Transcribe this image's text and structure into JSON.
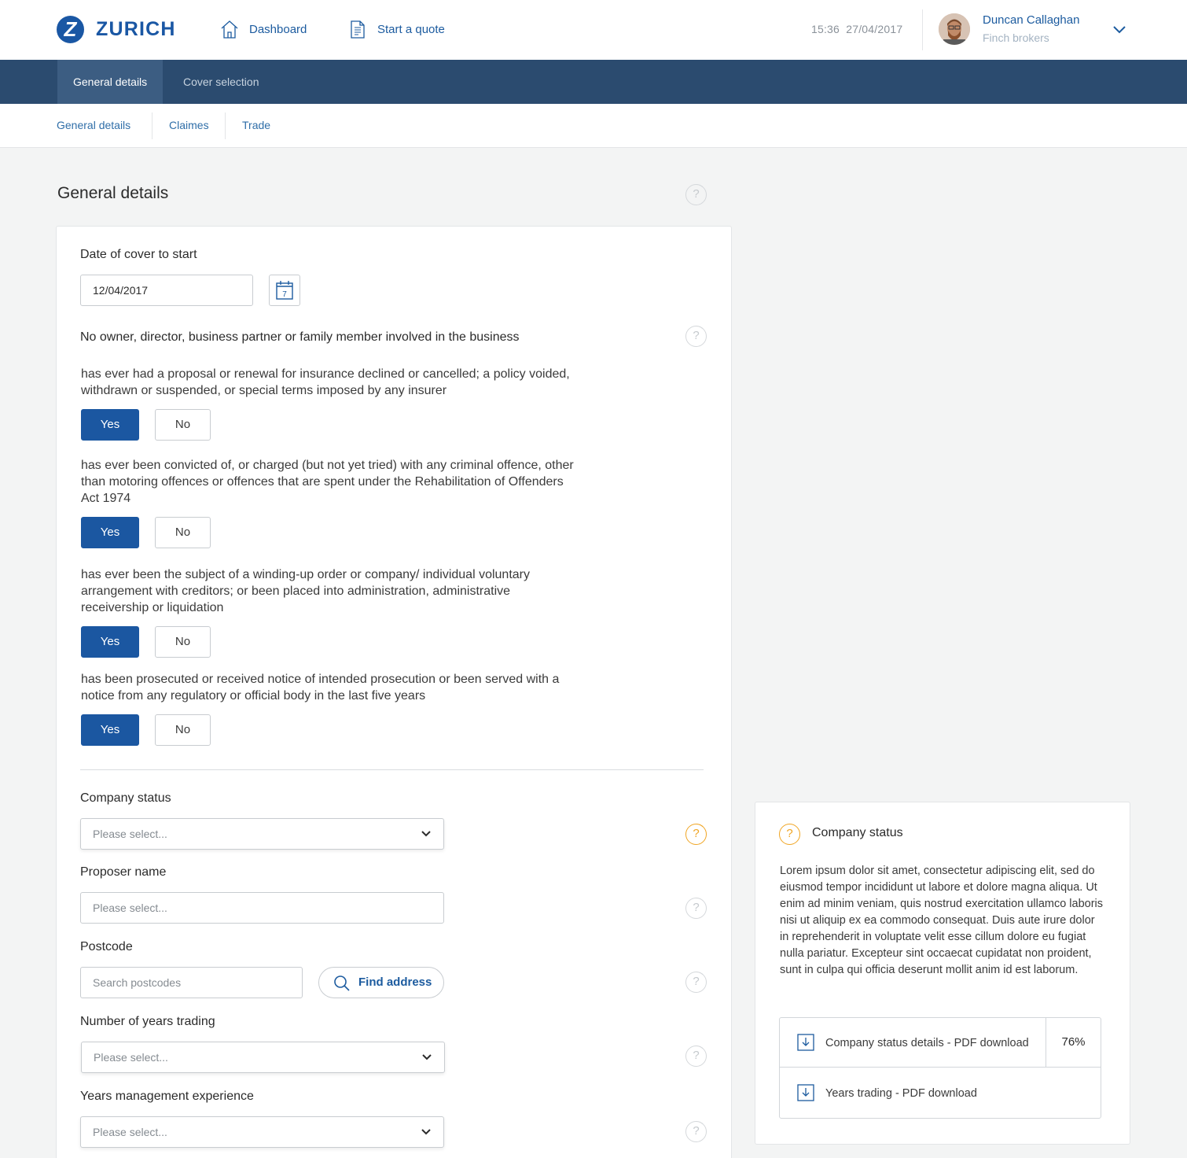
{
  "header": {
    "brand": "ZURICH",
    "logo_letter": "Z",
    "nav": [
      {
        "label": "Dashboard",
        "icon": "home-icon"
      },
      {
        "label": "Start a quote",
        "icon": "document-icon"
      }
    ],
    "time": "15:36",
    "date": "27/04/2017",
    "user": {
      "name": "Duncan Callaghan",
      "org": "Finch brokers"
    }
  },
  "tabs": [
    {
      "label": "General details",
      "active": true
    },
    {
      "label": "Cover selection",
      "active": false
    }
  ],
  "subnav": [
    "General details",
    "Claimes",
    "Trade"
  ],
  "page_title": "General details",
  "form": {
    "date_label": "Date of cover to start",
    "date_value": "12/04/2017",
    "calendar_day": "7",
    "questions_heading": "No owner, director, business partner or family member involved in the business",
    "questions": [
      {
        "text": "has ever had a proposal or renewal for insurance declined or cancelled; a policy voided, withdrawn or suspended, or special terms imposed by any insurer",
        "yes": "Yes",
        "no": "No",
        "selected": "Yes"
      },
      {
        "text": "has ever been convicted of, or charged (but not yet tried) with any criminal offence, other than motoring offences or offences that are spent under the Rehabilitation of Offenders Act 1974",
        "yes": "Yes",
        "no": "No",
        "selected": "Yes"
      },
      {
        "text": "has ever been the subject of a winding-up order or company/ individual voluntary arrangement with creditors; or been placed into administration, administrative receivership or liquidation",
        "yes": "Yes",
        "no": "No",
        "selected": "Yes"
      },
      {
        "text": "has been prosecuted or received notice of intended prosecution or been served with a notice from any regulatory or official body in the last five years",
        "yes": "Yes",
        "no": "No",
        "selected": "Yes"
      }
    ],
    "company_status": {
      "label": "Company status",
      "placeholder": "Please select..."
    },
    "proposer_name": {
      "label": "Proposer name",
      "placeholder": "Please select..."
    },
    "postcode": {
      "label": "Postcode",
      "placeholder": "Search postcodes",
      "button": "Find address"
    },
    "years_trading": {
      "label": "Number of years trading",
      "placeholder": "Please select..."
    },
    "mgmt_experience": {
      "label": "Years management experience",
      "placeholder": "Please select..."
    }
  },
  "help_panel": {
    "title": "Company status",
    "body": "Lorem ipsum dolor sit amet, consectetur adipiscing elit, sed do eiusmod tempor incididunt ut labore et dolore magna aliqua. Ut enim ad minim veniam, quis nostrud exercitation ullamco laboris nisi ut aliquip ex ea commodo consequat. Duis aute irure dolor in reprehenderit in voluptate velit esse cillum dolore eu fugiat nulla pariatur. Excepteur sint occaecat cupidatat non proident, sunt in culpa qui officia deserunt mollit anim id est laborum.",
    "downloads": [
      {
        "label": "Company status details - PDF download",
        "progress": "76%"
      },
      {
        "label": "Years trading - PDF download"
      }
    ]
  },
  "help_glyph": "?",
  "colors": {
    "primary": "#1b57a1",
    "navbar": "#2b4b6f",
    "tab_active": "#3c5d82",
    "help_active": "#f0a523"
  }
}
